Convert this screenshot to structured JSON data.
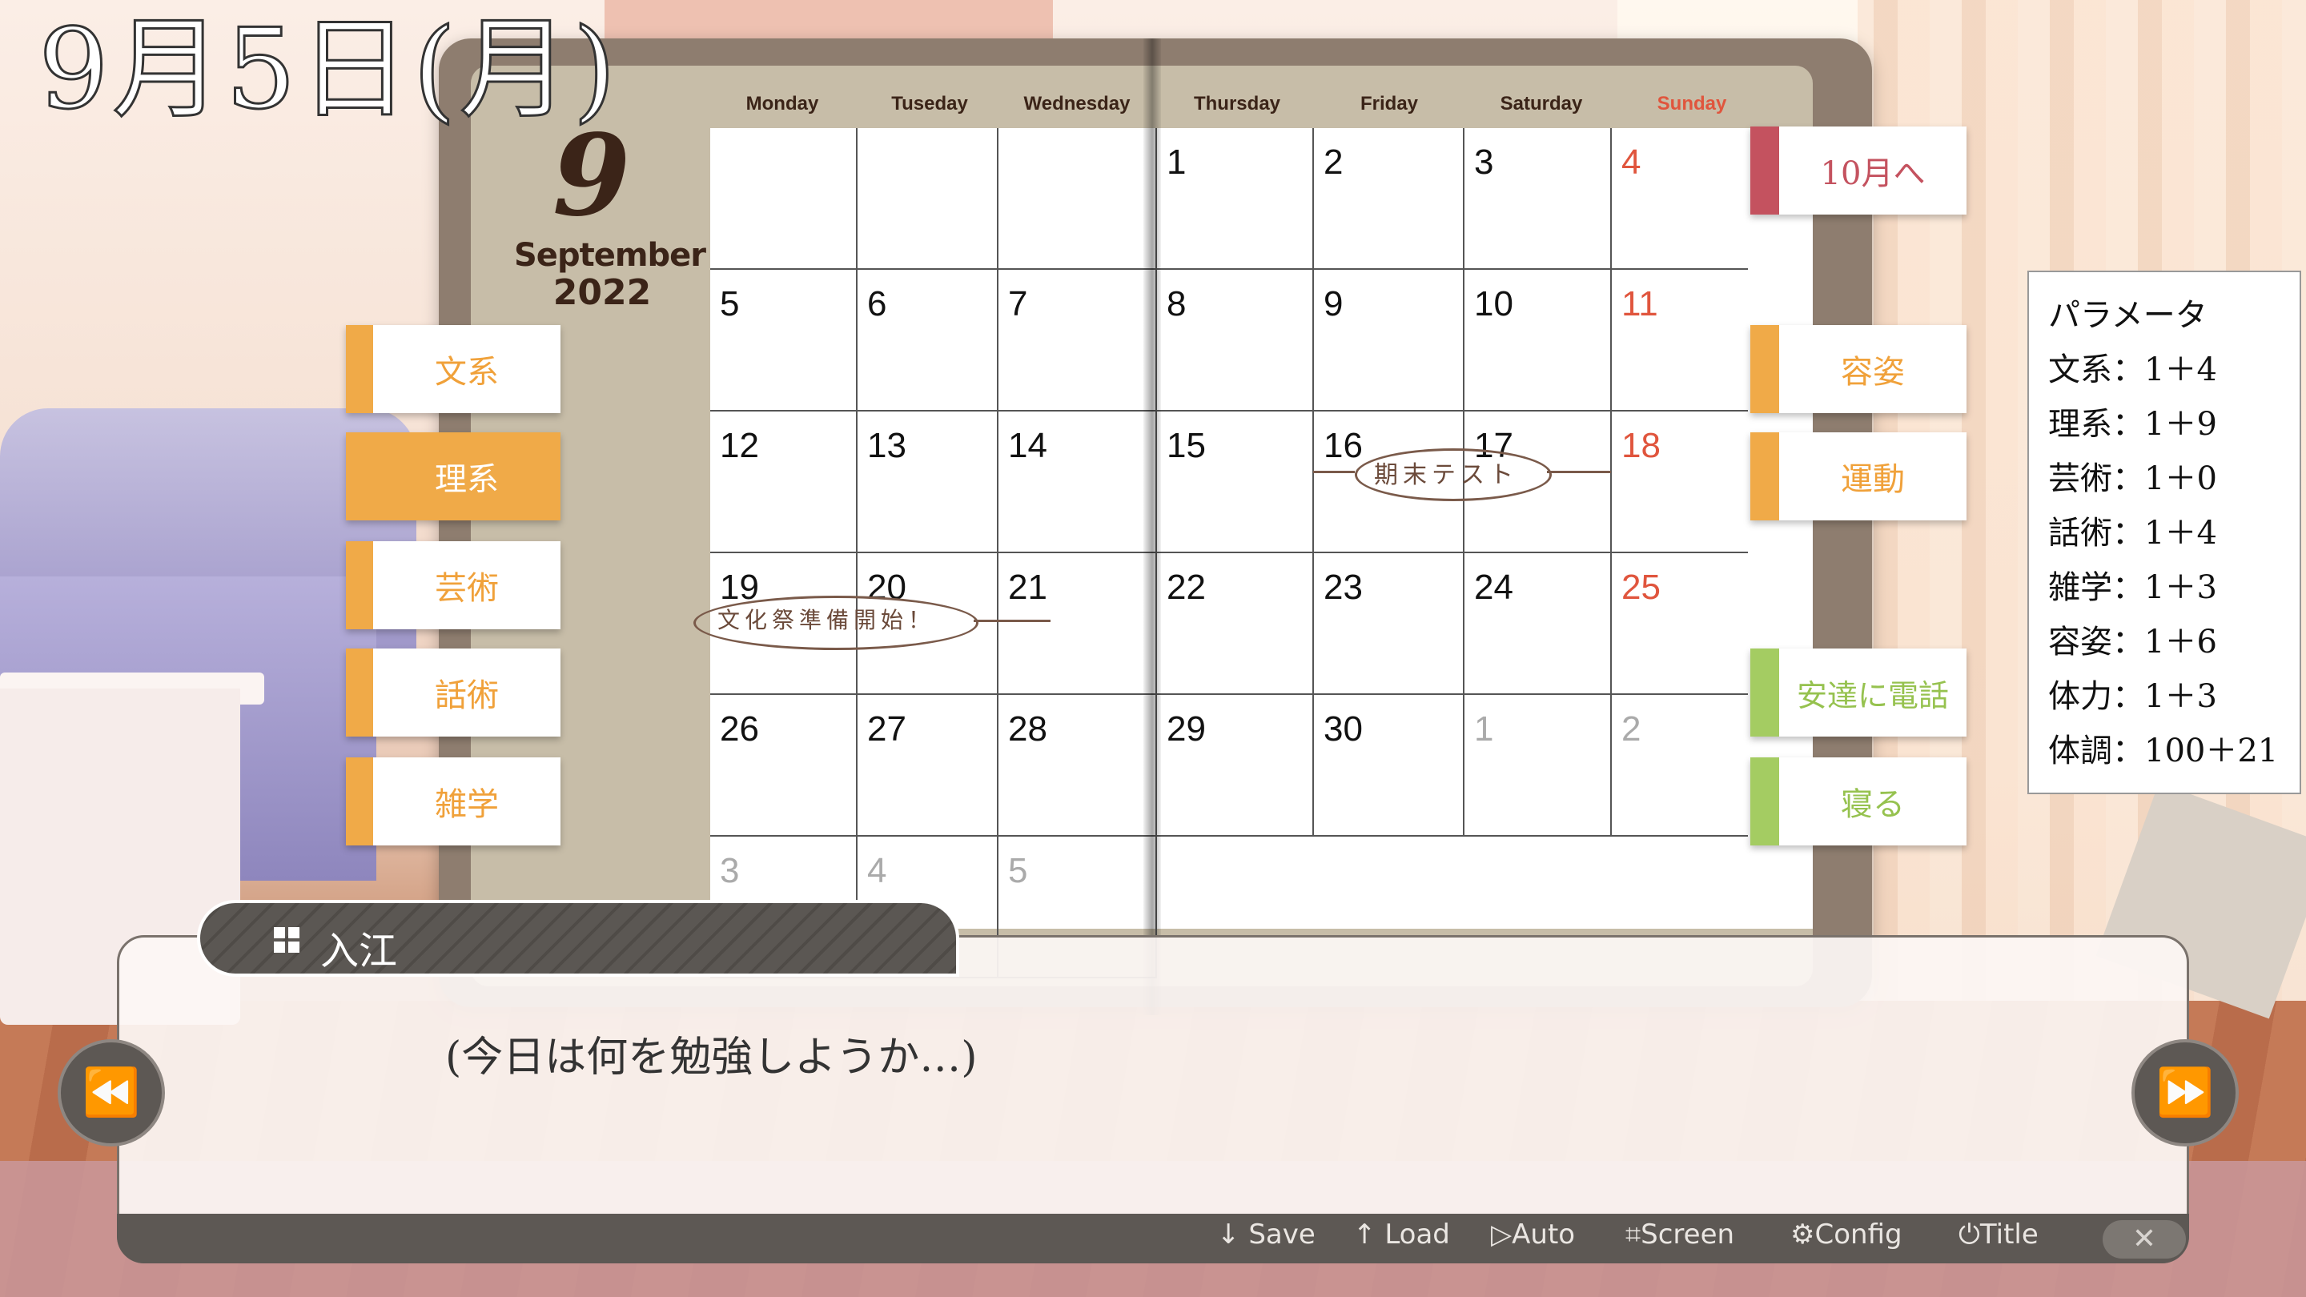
{
  "date_title": "9月5日(月)",
  "calendar": {
    "month_number": "9",
    "month_name": "September",
    "year": "2022",
    "weekdays": [
      "Monday",
      "Tuseday",
      "Wednesday",
      "Thursday",
      "Friday",
      "Saturday",
      "Sunday"
    ],
    "sunday_color": "#e0553d",
    "weeks": [
      [
        "",
        "",
        "",
        "1",
        "2",
        "3",
        "4"
      ],
      [
        "5",
        "6",
        "7",
        "8",
        "9",
        "10",
        "11"
      ],
      [
        "12",
        "13",
        "14",
        "15",
        "16",
        "17",
        "18"
      ],
      [
        "19",
        "20",
        "21",
        "22",
        "23",
        "24",
        "25"
      ],
      [
        "26",
        "27",
        "28",
        "29",
        "30",
        "1",
        "2"
      ],
      [
        "3",
        "4",
        "5",
        "",
        "",
        "",
        ""
      ]
    ],
    "events": [
      {
        "text": "期末テスト"
      },
      {
        "text": "文化祭準備開始！"
      }
    ]
  },
  "left_menu": [
    {
      "label": "文系",
      "active": false
    },
    {
      "label": "理系",
      "active": true
    },
    {
      "label": "芸術",
      "active": false
    },
    {
      "label": "話術",
      "active": false
    },
    {
      "label": "雑学",
      "active": false
    }
  ],
  "right_menu": {
    "next_month": "10月へ",
    "appearance": "容姿",
    "exercise": "運動",
    "call": "安達に電話",
    "sleep": "寝る"
  },
  "parameters": {
    "title": "パラメータ",
    "rows": [
      "文系：1＋4",
      "理系：1＋9",
      "芸術：1＋0",
      "話術：1＋4",
      "雑学：1＋3",
      "容姿：1＋6",
      "体力：1＋3",
      "体調：100＋21"
    ]
  },
  "dialogue": {
    "speaker": "入江",
    "text": "(今日は何を勉強しようか…)"
  },
  "toolbar": {
    "save": "Save",
    "load": "Load",
    "auto": "Auto",
    "screen": "Screen",
    "config": "Config",
    "title": "Title",
    "close": "✕"
  },
  "colors": {
    "study_accent": "#f0aa48",
    "month_accent": "#c4525f",
    "action_accent": "#a4cc62"
  }
}
